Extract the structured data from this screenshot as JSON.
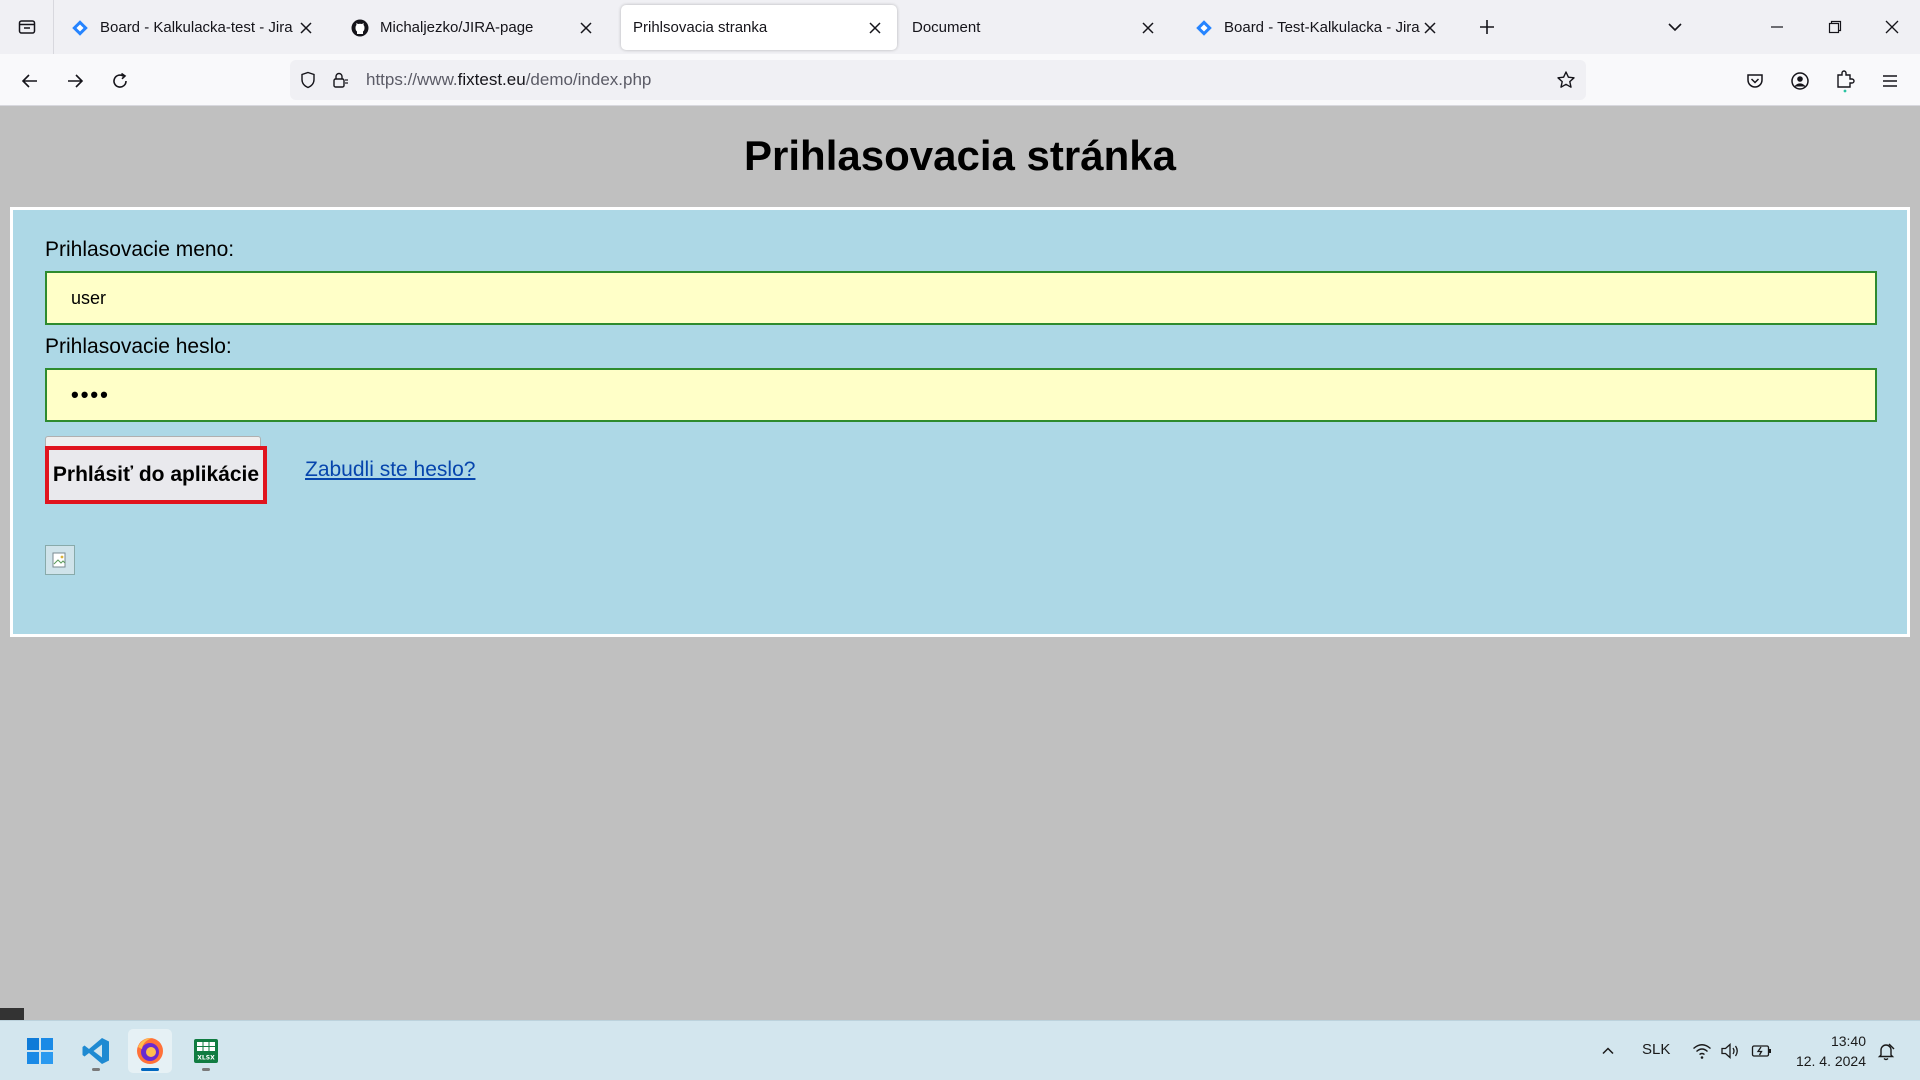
{
  "browser": {
    "tabs": [
      {
        "title": "Board - Kalkulacka-test - Jira",
        "favicon": "jira-icon"
      },
      {
        "title": "Michaljezko/JIRA-page",
        "favicon": "github-icon"
      },
      {
        "title": "Prihlsovacia stranka",
        "favicon": "none"
      },
      {
        "title": "Document",
        "favicon": "none"
      },
      {
        "title": "Board - Test-Kalkulacka - Jira",
        "favicon": "jira-icon"
      }
    ],
    "url_prefix": "https://www.",
    "url_host": "fixtest.eu",
    "url_path": "/demo/index.php"
  },
  "page": {
    "title": "Prihlasovacia stránka",
    "username_label": "Prihlasovacie meno:",
    "username_value": "user",
    "password_label": "Prihlasovacie heslo:",
    "password_value": "••••",
    "login_button": "Prhlásiť do aplikácie",
    "forgot_link": "Zabudli ste heslo?"
  },
  "colors": {
    "page_bg": "#c0c0c0",
    "panel_bg": "#add8e6",
    "input_bg": "#ffffc8",
    "input_border": "#2e8b2e",
    "highlight_border": "#e0141e",
    "link": "#0645ad"
  },
  "taskbar": {
    "language": "SLK",
    "time": "13:40",
    "date": "12. 4. 2024"
  }
}
